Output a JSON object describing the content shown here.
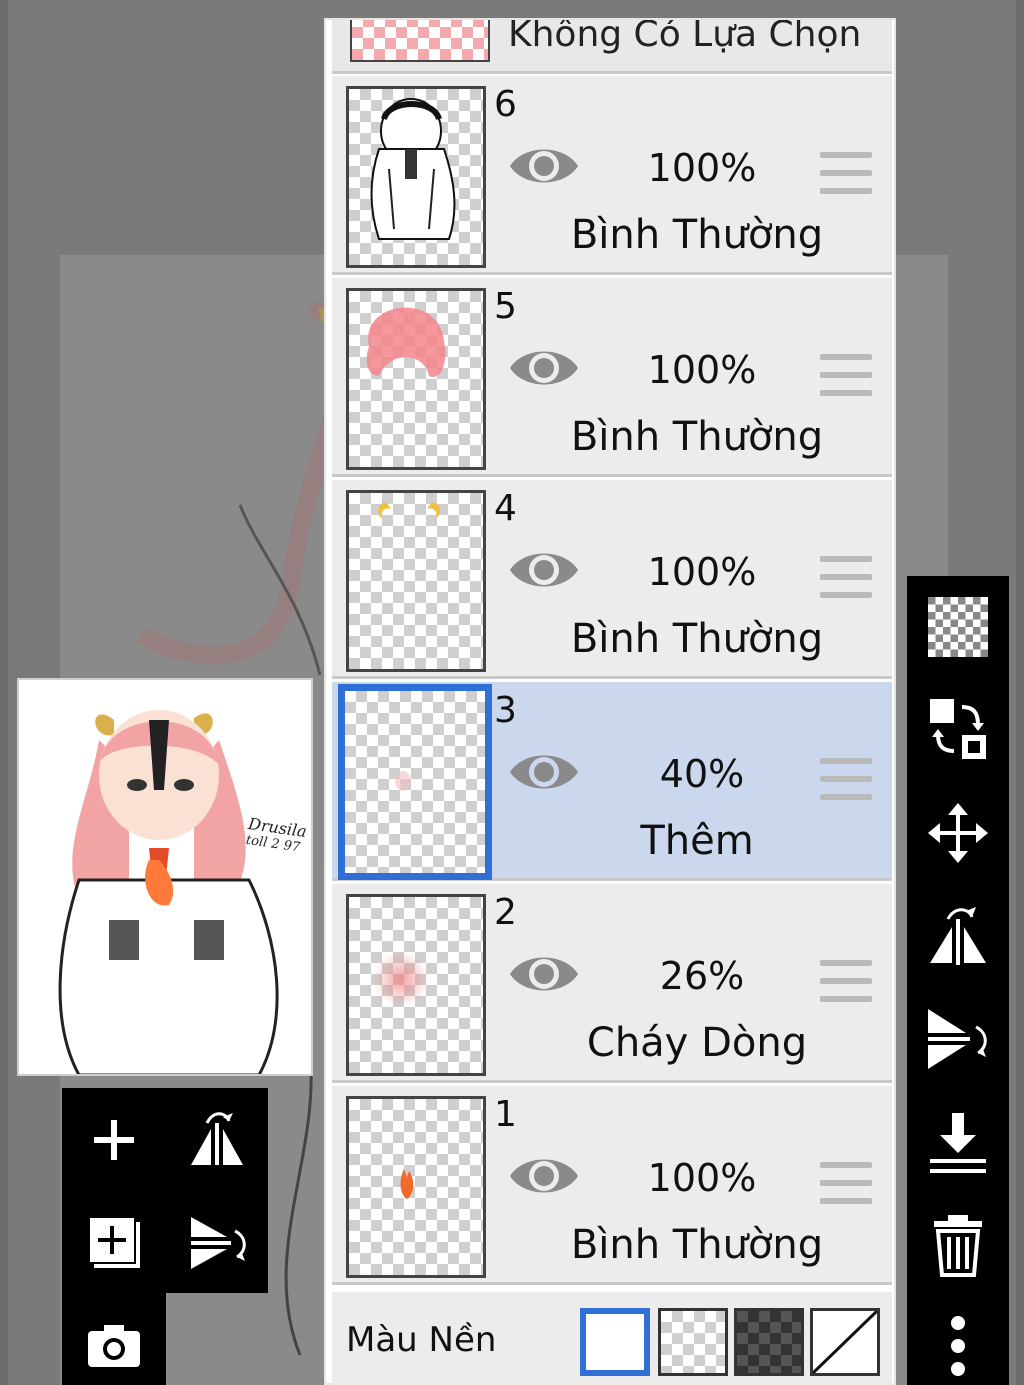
{
  "layers_panel": {
    "no_selection_label": "Không Có Lựa Chọn",
    "layers": [
      {
        "number": "6",
        "opacity": "100%",
        "blend": "Bình Thường",
        "visible": true,
        "selected": false
      },
      {
        "number": "5",
        "opacity": "100%",
        "blend": "Bình Thường",
        "visible": true,
        "selected": false
      },
      {
        "number": "4",
        "opacity": "100%",
        "blend": "Bình Thường",
        "visible": true,
        "selected": false
      },
      {
        "number": "3",
        "opacity": "40%",
        "blend": "Thêm",
        "visible": true,
        "selected": true
      },
      {
        "number": "2",
        "opacity": "26%",
        "blend": "Cháy Dòng",
        "visible": true,
        "selected": false
      },
      {
        "number": "1",
        "opacity": "100%",
        "blend": "Bình Thường",
        "visible": true,
        "selected": false
      }
    ],
    "background": {
      "label": "Màu Nền",
      "options": [
        "white",
        "transparent",
        "dark-checker",
        "none"
      ],
      "selected": "white"
    }
  },
  "preview": {
    "signature_line1": "Drusila",
    "signature_line2": "toll 2 97"
  },
  "left_toolbar": [
    "add-layer-icon",
    "flip-horizontal-icon",
    "add-layer-copy-icon",
    "flip-vertical-icon",
    "camera-icon"
  ],
  "right_toolbar": [
    "transparency-icon",
    "swap-layers-icon",
    "move-icon",
    "flip-horizontal-icon",
    "flip-vertical-icon",
    "merge-down-icon",
    "delete-icon",
    "more-icon"
  ],
  "colors": {
    "selection_blue": "#2f6fd6",
    "selected_row": "#cbd7ec",
    "panel_row": "#ececec",
    "toolbar": "#000000"
  }
}
